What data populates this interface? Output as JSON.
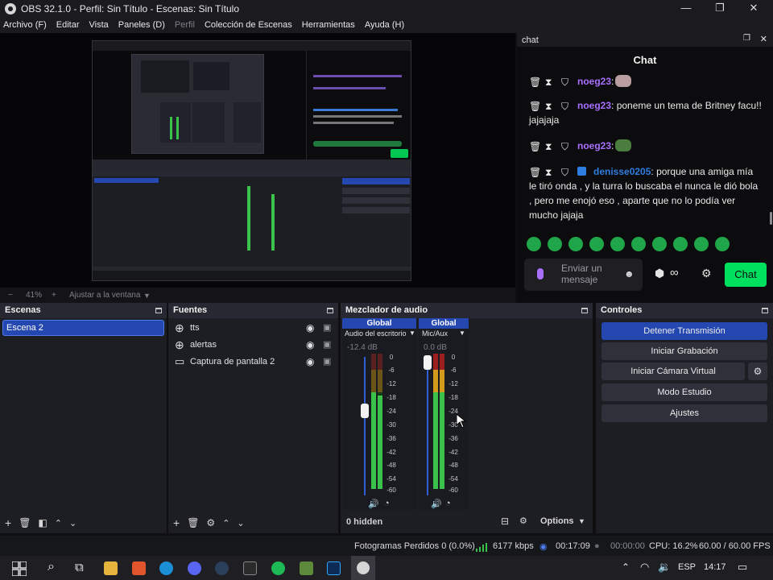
{
  "window": {
    "title": "OBS 32.1.0 - Perfil: Sin Título - Escenas: Sin Título"
  },
  "menu": {
    "items": [
      "Archivo (F)",
      "Editar",
      "Vista",
      "Paneles (D)",
      "Perfil",
      "Colección de Escenas",
      "Herramientas",
      "Ayuda (H)"
    ]
  },
  "zoom": {
    "minus": "−",
    "value": "41%",
    "plus": "+",
    "fit_label": "Ajustar a la ventana"
  },
  "chat": {
    "dock_title": "chat",
    "title": "Chat",
    "messages": [
      {
        "user": "noeg23",
        "sep": ":",
        "text": ""
      },
      {
        "user": "noeg23",
        "sep": ":",
        "text": " poneme un tema de Britney facu!! jajajaja"
      },
      {
        "user": "noeg23",
        "sep": ":",
        "text": ""
      },
      {
        "user": "denisse0205",
        "sep": ":",
        "text": " porque una amiga mía le tiró onda , y la turra lo buscaba el nunca le dió bola , pero me enojó eso , aparte que no lo podía ver mucho jajaja"
      }
    ],
    "input_placeholder": "Enviar un mensaje",
    "send_label": "Chat",
    "colors": {
      "purple": "#a970ff",
      "blue": "#2e7de0",
      "green": "#00e05f"
    }
  },
  "scenes": {
    "title": "Escenas",
    "items": [
      "Escena 2"
    ]
  },
  "sources": {
    "title": "Fuentes",
    "items": [
      {
        "label": "tts",
        "icon": "globe-icon"
      },
      {
        "label": "alertas",
        "icon": "globe-icon"
      },
      {
        "label": "Captura de pantalla 2",
        "icon": "monitor-icon"
      }
    ]
  },
  "mixer": {
    "title": "Mezclador de audio",
    "channels": [
      {
        "header": "Global",
        "name": "Audio del escritorio",
        "db": "-12.4 dB",
        "level": 0.78
      },
      {
        "header": "Global",
        "name": "Mic/Aux",
        "db": "0.0 dB",
        "level": 1.0
      }
    ],
    "ticks": [
      "0",
      "-6",
      "-12",
      "-18",
      "-24",
      "-30",
      "-36",
      "-42",
      "-48",
      "-54",
      "-60"
    ],
    "hidden_label": "0 hidden",
    "options_label": "Options"
  },
  "controls": {
    "title": "Controles",
    "stop_stream": "Detener Transmisión",
    "start_record": "Iniciar Grabación",
    "start_vcam": "Iniciar Cámara Virtual",
    "studio_mode": "Modo Estudio",
    "settings": "Ajustes"
  },
  "status": {
    "dropped": "Fotogramas Perdidos 0 (0.0%)",
    "kbps": "6177 kbps",
    "stream_time": "00:17:09",
    "rec_time": "00:00:00",
    "cpu": "CPU: 16.2%",
    "fps": "60.00 / 60.00 FPS"
  },
  "taskbar": {
    "lang": "ESP",
    "time": "14:17"
  }
}
